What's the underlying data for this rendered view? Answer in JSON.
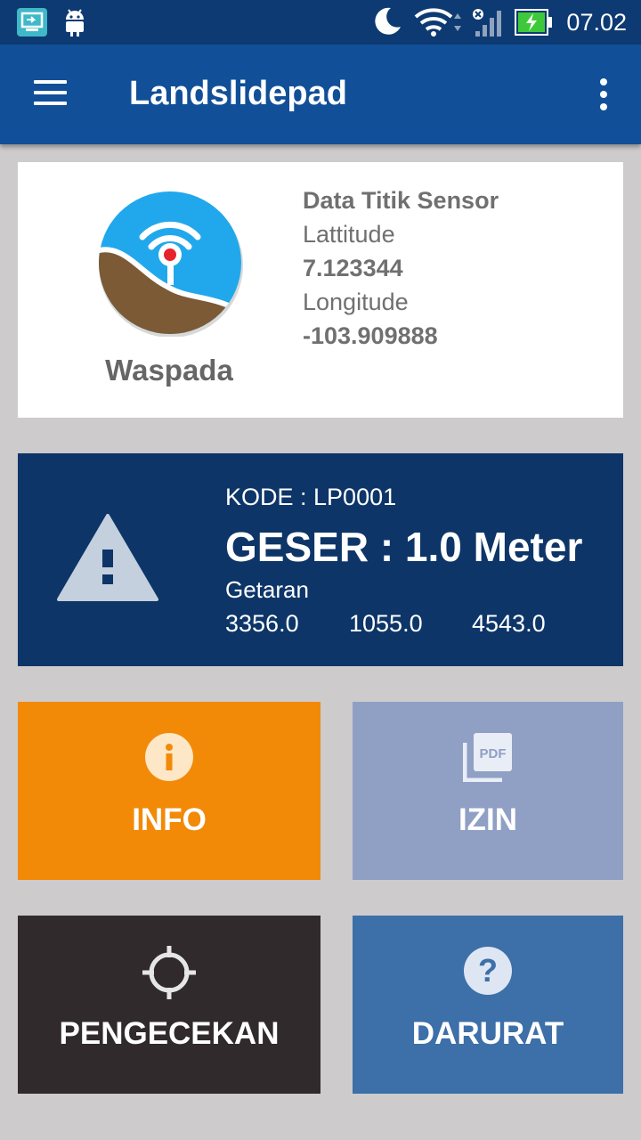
{
  "status_bar": {
    "time": "07.02"
  },
  "app_bar": {
    "title": "Landslidepad"
  },
  "sensor_card": {
    "logo_caption": "Waspada",
    "heading": "Data Titik Sensor",
    "latitude_label": "Lattitude",
    "latitude_value": "7.123344",
    "longitude_label": "Longitude",
    "longitude_value": "-103.909888"
  },
  "status_card": {
    "kode": "KODE : LP0001",
    "geser": "GESER : 1.0 Meter",
    "getaran_label": "Getaran",
    "getaran_values": [
      "3356.0",
      "1055.0",
      "4543.0"
    ]
  },
  "tiles": {
    "info": "INFO",
    "izin": "IZIN",
    "pengecekan": "PENGECEKAN",
    "darurat": "DARURAT"
  },
  "icons": {
    "tile_info": "info-circle-icon",
    "tile_izin": "pdf-document-icon",
    "tile_pengecekan": "crosshair-icon",
    "tile_darurat": "help-circle-icon",
    "status": "warning-triangle-icon"
  },
  "colors": {
    "status_bar": "#0d3a72",
    "app_bar": "#114f98",
    "status_card": "#0d3568",
    "info_tile": "#f28a08",
    "izin_tile": "#909fc4",
    "pengecekan_tile": "#302a2c",
    "darurat_tile": "#3d6fa9"
  }
}
